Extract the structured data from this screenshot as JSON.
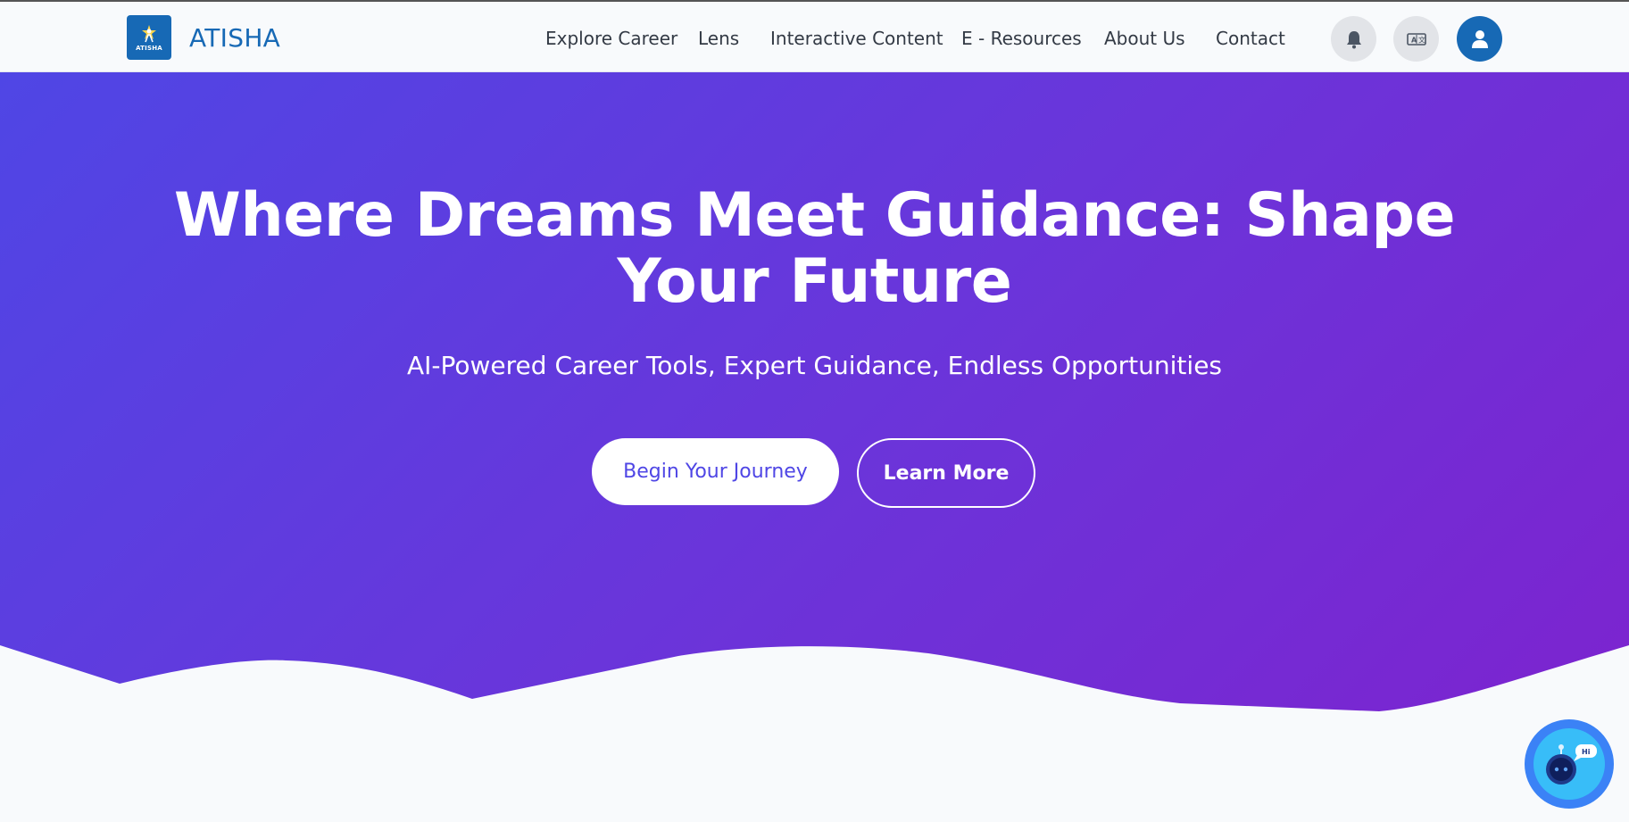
{
  "brand": {
    "name": "ATISHA",
    "logo_text": "ATISHA"
  },
  "nav": {
    "items": [
      {
        "label": "Explore Career"
      },
      {
        "label": "Lens"
      },
      {
        "label": "Interactive Content"
      },
      {
        "label": "E - Resources"
      },
      {
        "label": "About Us"
      },
      {
        "label": "Contact"
      }
    ]
  },
  "header_icons": [
    "bell-icon",
    "translate-icon",
    "user-icon"
  ],
  "hero": {
    "title_line1": "Where Dreams Meet Guidance: Shape",
    "title_line2": "Your Future",
    "subtitle": "AI-Powered Career Tools, Expert Guidance, Endless Opportunities",
    "primary_button": "Begin Your Journey",
    "secondary_button": "Learn More"
  },
  "chatbot": {
    "bubble_text": "Hi"
  },
  "colors": {
    "brand_blue": "#1769b5",
    "hero_gradient_start": "#4f46e5",
    "hero_gradient_end": "#7e22ce",
    "chatbot": "#3b82f6"
  }
}
